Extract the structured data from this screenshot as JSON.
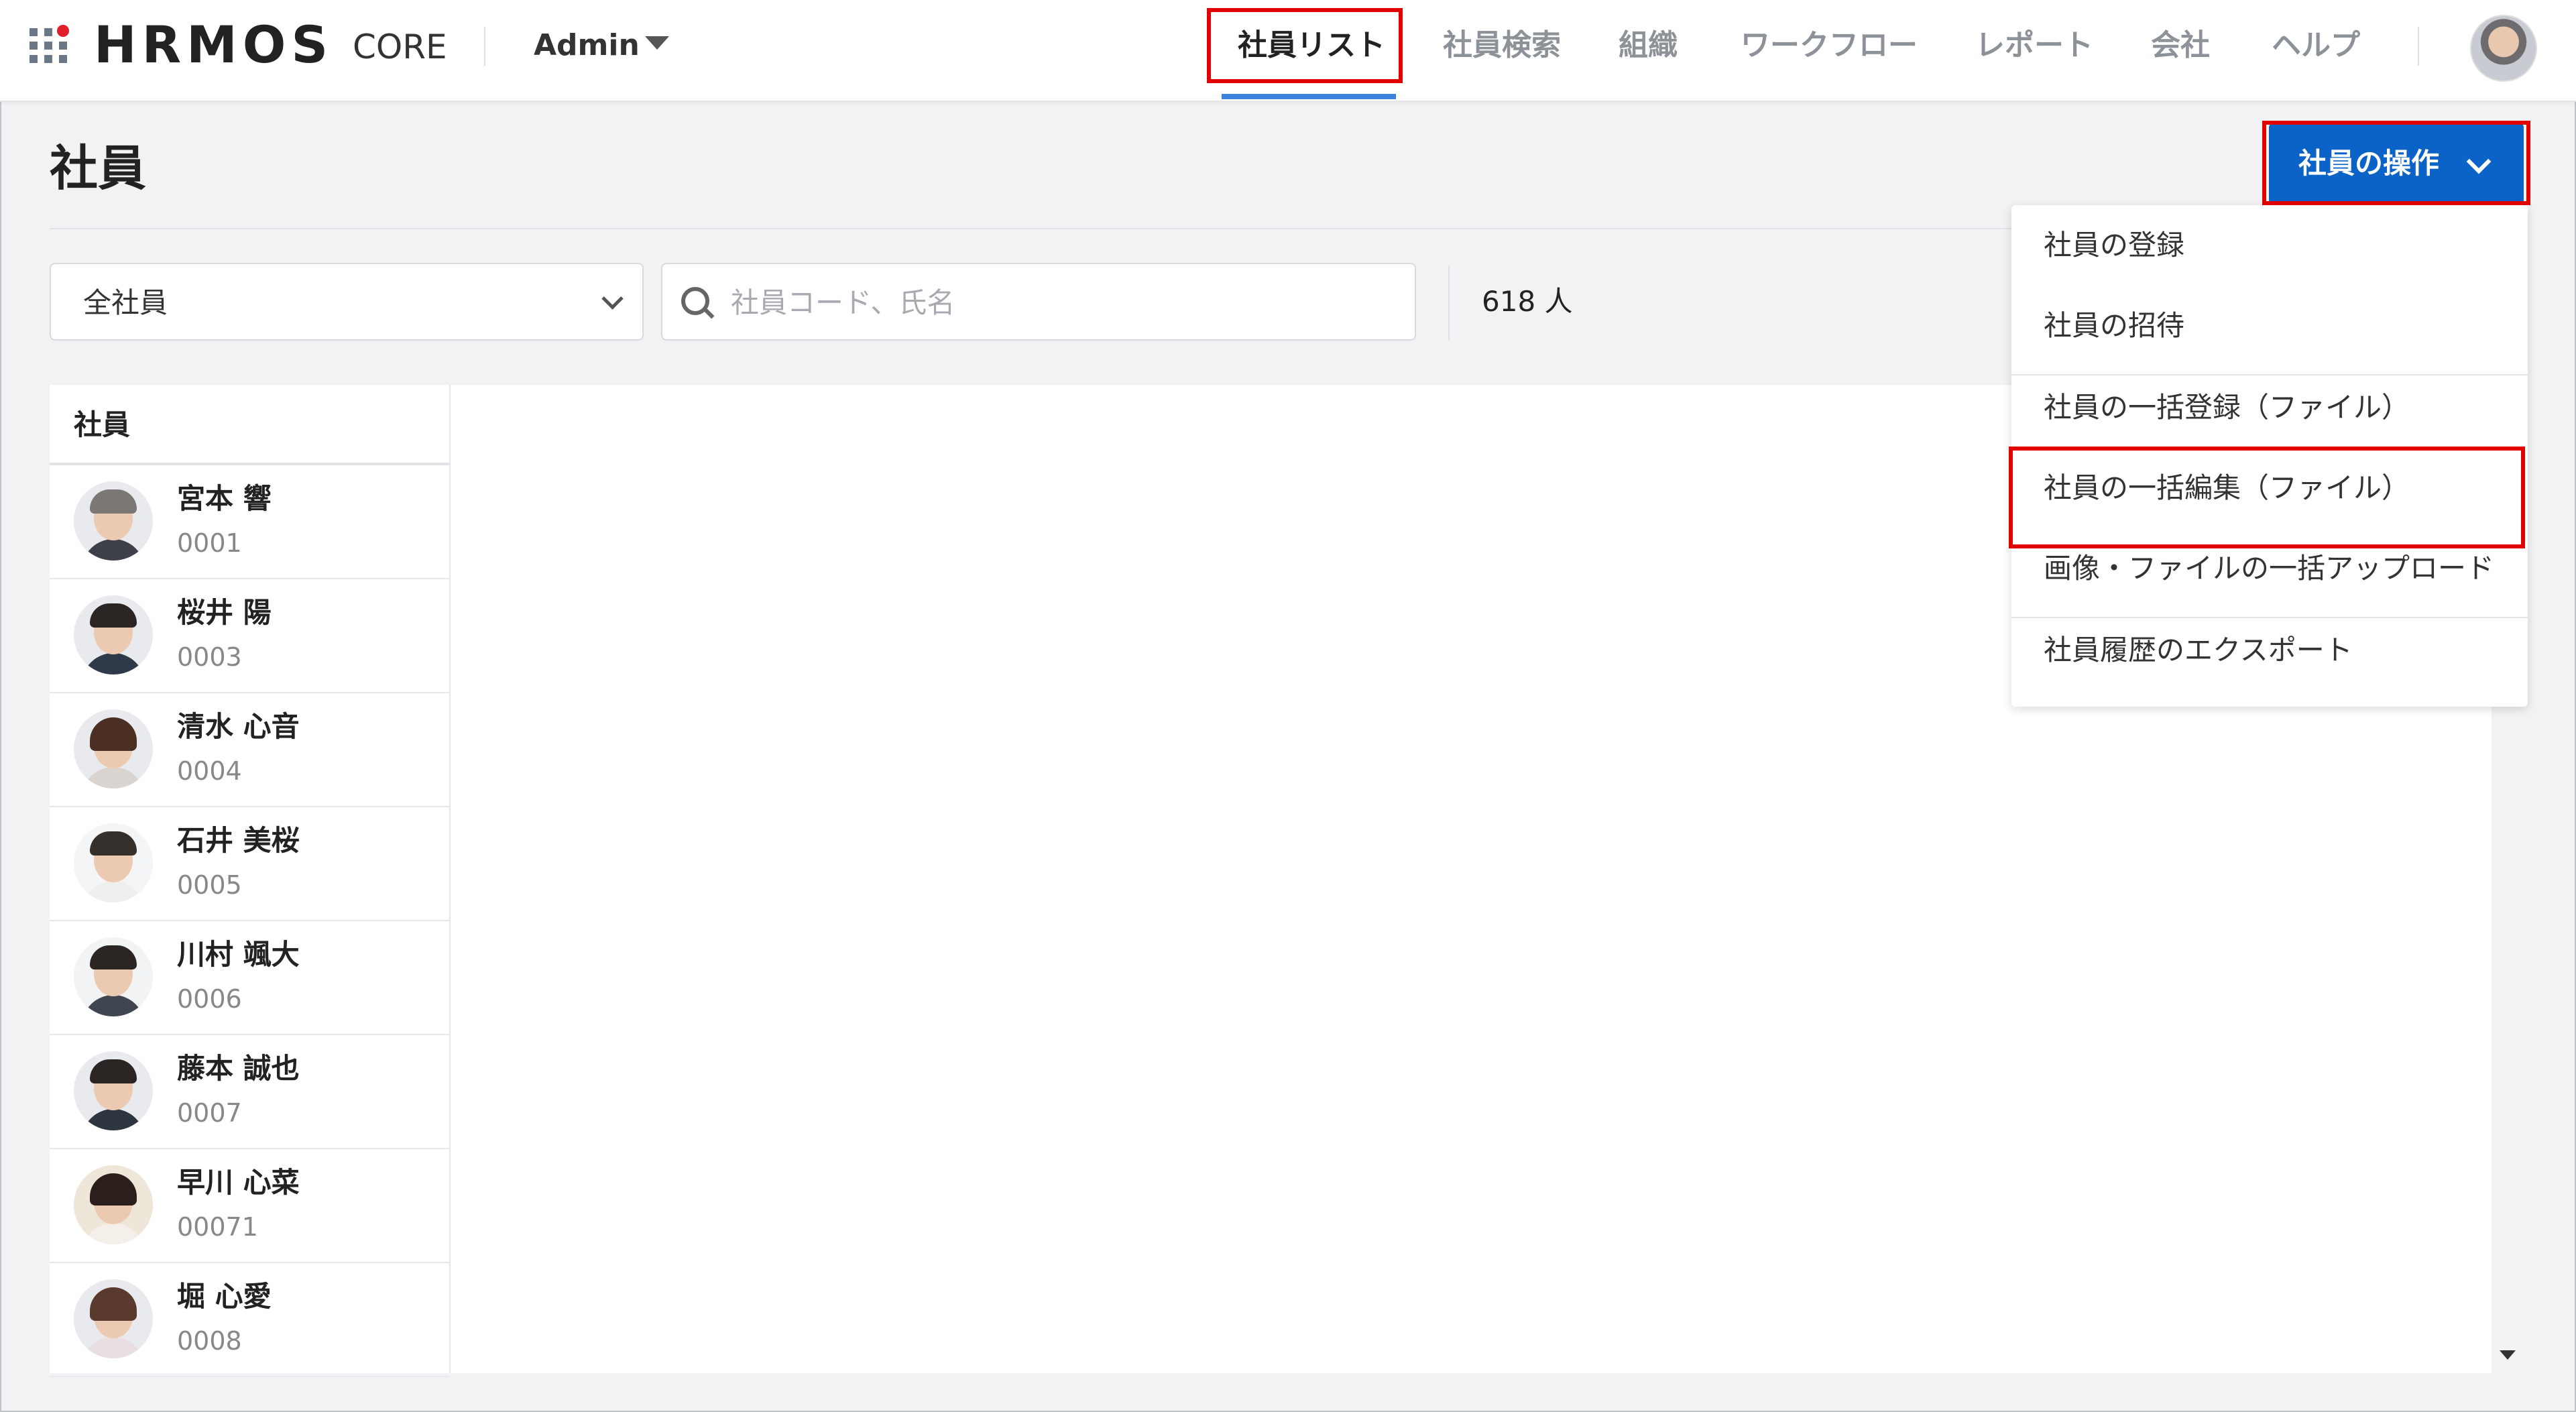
{
  "header": {
    "logo": "HRMOS",
    "product": "CORE",
    "workspace": "Admin",
    "nav": [
      {
        "label": "社員リスト",
        "active": true
      },
      {
        "label": "社員検索"
      },
      {
        "label": "組織"
      },
      {
        "label": "ワークフロー"
      },
      {
        "label": "レポート"
      },
      {
        "label": "会社"
      },
      {
        "label": "ヘルプ"
      }
    ],
    "icons": {
      "apps": "grid-apps-icon",
      "workspace_toggle": "chevron-down-icon",
      "user": "user-avatar"
    }
  },
  "page": {
    "title": "社員",
    "actions_button": "社員の操作"
  },
  "filters": {
    "group_select": "全社員",
    "search_placeholder": "社員コード、氏名",
    "count": "618 人"
  },
  "actions_menu": {
    "items": [
      "社員の登録",
      "社員の招待",
      "社員の一括登録（ファイル）",
      "社員の一括編集（ファイル）",
      "画像・ファイルの一括アップロード",
      "社員履歴のエクスポート"
    ],
    "highlighted": "社員の一括編集（ファイル）"
  },
  "employee_list": {
    "header": "社員",
    "rows": [
      {
        "name": "宮本 響",
        "code": "0001"
      },
      {
        "name": "桜井 陽",
        "code": "0003"
      },
      {
        "name": "清水 心音",
        "code": "0004"
      },
      {
        "name": "石井 美桜",
        "code": "0005"
      },
      {
        "name": "川村 颯大",
        "code": "0006"
      },
      {
        "name": "藤本 誠也",
        "code": "0007"
      },
      {
        "name": "早川 心菜",
        "code": "00071"
      },
      {
        "name": "堀 心愛",
        "code": "0008"
      }
    ]
  },
  "colors": {
    "accent": "#0b63c7",
    "highlight_frame": "#e30000",
    "nav_underline": "#3b82e0"
  }
}
